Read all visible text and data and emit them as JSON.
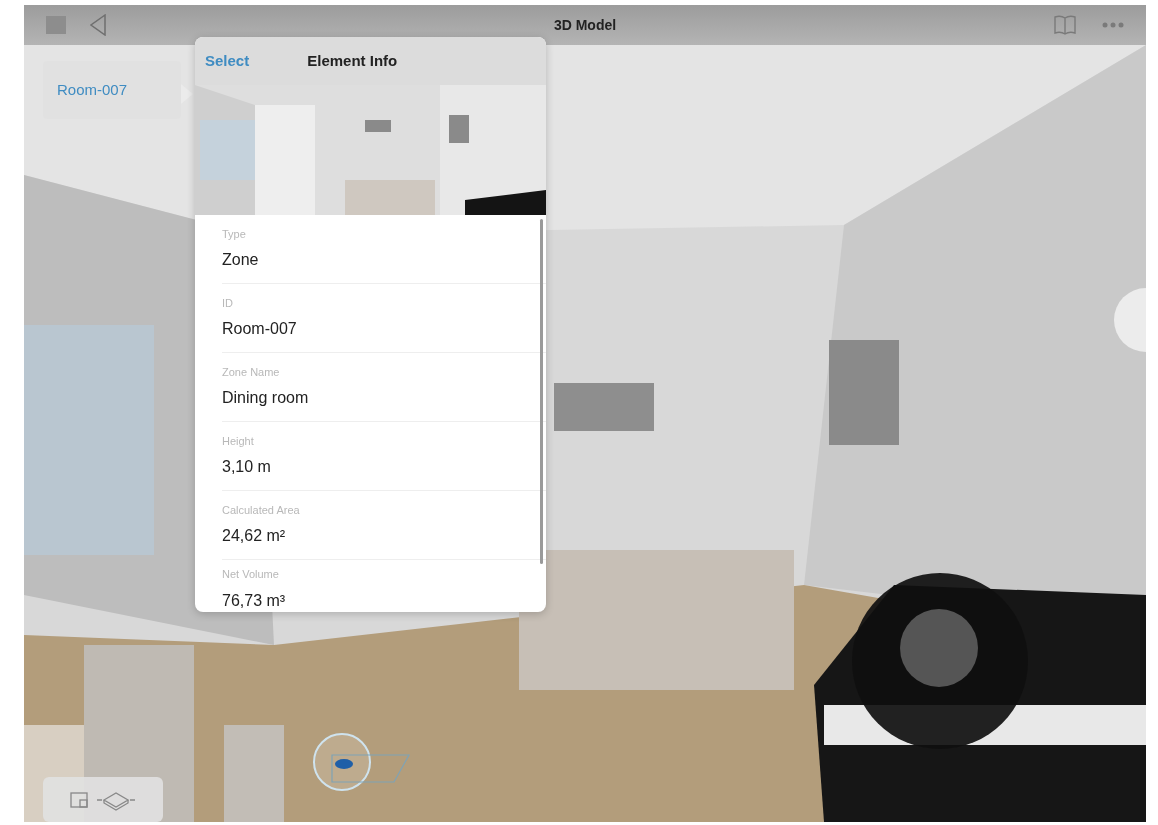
{
  "top_bar": {
    "title": "3D Model"
  },
  "room_tag": {
    "label": "Room-007"
  },
  "popover": {
    "select_button": "Select",
    "title": "Element Info",
    "properties": [
      {
        "label": "Type",
        "value": "Zone"
      },
      {
        "label": "ID",
        "value": "Room-007"
      },
      {
        "label": "Zone Name",
        "value": "Dining room"
      },
      {
        "label": "Height",
        "value": "3,10 m"
      },
      {
        "label": "Calculated Area",
        "value": "24,62 m²"
      },
      {
        "label": "Net Volume",
        "value": "76,73 m³"
      }
    ]
  }
}
